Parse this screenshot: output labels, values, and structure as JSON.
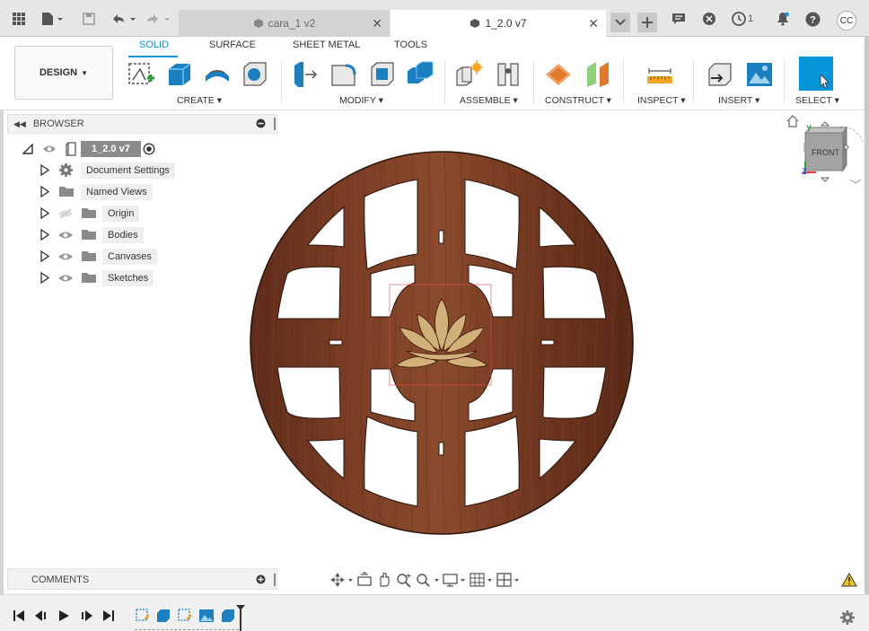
{
  "titlebar": {
    "tabs": [
      {
        "label": "cara_1 v2",
        "active": false
      },
      {
        "label": "1_2.0 v7",
        "active": true
      }
    ],
    "job_count": "1",
    "avatar_initials": "CC"
  },
  "ribbon": {
    "workspace_label": "DESIGN",
    "tabs": [
      "SOLID",
      "SURFACE",
      "SHEET METAL",
      "TOOLS"
    ],
    "active_tab": "SOLID",
    "groups": [
      "CREATE",
      "MODIFY",
      "ASSEMBLE",
      "CONSTRUCT",
      "INSPECT",
      "INSERT",
      "SELECT"
    ]
  },
  "browser": {
    "title": "BROWSER",
    "root": "1_2.0 v7",
    "items": [
      {
        "label": "Document Settings",
        "icon": "gear-icon"
      },
      {
        "label": "Named Views",
        "icon": "folder-icon"
      },
      {
        "label": "Origin",
        "icon": "folder-icon",
        "hidden": true
      },
      {
        "label": "Bodies",
        "icon": "folder-icon"
      },
      {
        "label": "Canvases",
        "icon": "folder-icon"
      },
      {
        "label": "Sketches",
        "icon": "folder-icon"
      }
    ]
  },
  "viewcube": {
    "face": "FRONT",
    "axis_y": "Y",
    "axis_z": "Z"
  },
  "comments": {
    "title": "COMMENTS"
  },
  "colors": {
    "accent": "#0696d7",
    "wood": "#6a3320",
    "lotus": "#d2b07a"
  }
}
